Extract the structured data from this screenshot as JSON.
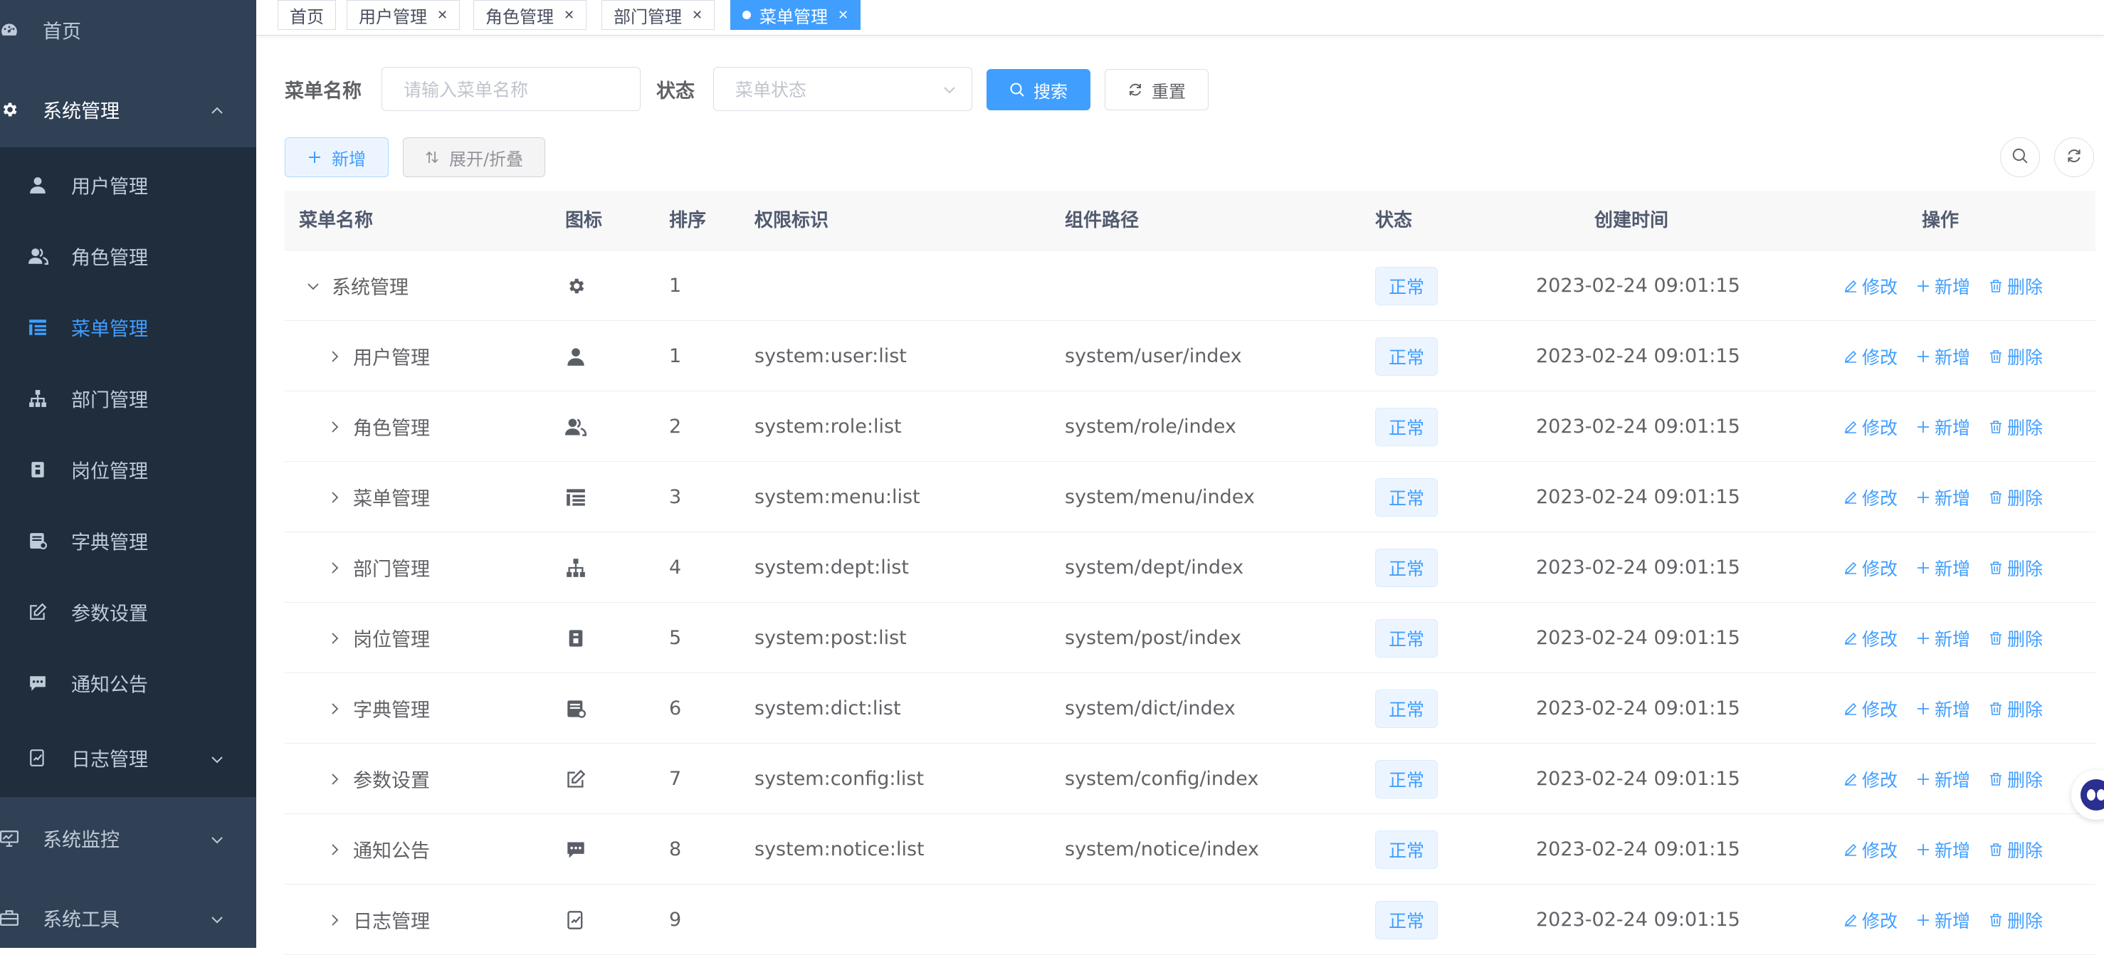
{
  "sidebar": {
    "items": [
      {
        "label": "首页",
        "icon": "dashboard-icon"
      },
      {
        "label": "系统管理",
        "icon": "gear-icon"
      },
      {
        "label": "用户管理",
        "icon": "user-icon"
      },
      {
        "label": "角色管理",
        "icon": "peoples-icon"
      },
      {
        "label": "菜单管理",
        "icon": "tree-table-icon"
      },
      {
        "label": "部门管理",
        "icon": "org-tree-icon"
      },
      {
        "label": "岗位管理",
        "icon": "post-icon"
      },
      {
        "label": "字典管理",
        "icon": "dict-icon"
      },
      {
        "label": "参数设置",
        "icon": "edit-icon"
      },
      {
        "label": "通知公告",
        "icon": "message-icon"
      },
      {
        "label": "日志管理",
        "icon": "log-icon"
      },
      {
        "label": "系统监控",
        "icon": "monitor-icon"
      },
      {
        "label": "系统工具",
        "icon": "tool-icon"
      }
    ]
  },
  "tags": [
    {
      "label": "首页"
    },
    {
      "label": "用户管理"
    },
    {
      "label": "角色管理"
    },
    {
      "label": "部门管理"
    },
    {
      "label": "菜单管理"
    }
  ],
  "query": {
    "menu_name_label": "菜单名称",
    "menu_name_placeholder": "请输入菜单名称",
    "status_label": "状态",
    "status_placeholder": "菜单状态",
    "search_label": "搜索",
    "reset_label": "重置"
  },
  "toolbar": {
    "add_label": "新增",
    "expand_label": "展开/折叠"
  },
  "table": {
    "headers": [
      "菜单名称",
      "图标",
      "排序",
      "权限标识",
      "组件路径",
      "状态",
      "创建时间",
      "操作"
    ],
    "actions": {
      "edit": "修改",
      "add": "新增",
      "delete": "删除"
    },
    "rows": [
      {
        "name": "系统管理",
        "icon": "gear-icon",
        "order": "1",
        "perm": "",
        "component": "",
        "status": "正常",
        "created": "2023-02-24 09:01:15",
        "expanded": true
      },
      {
        "name": "用户管理",
        "icon": "user-icon",
        "order": "1",
        "perm": "system:user:list",
        "component": "system/user/index",
        "status": "正常",
        "created": "2023-02-24 09:01:15"
      },
      {
        "name": "角色管理",
        "icon": "peoples-icon",
        "order": "2",
        "perm": "system:role:list",
        "component": "system/role/index",
        "status": "正常",
        "created": "2023-02-24 09:01:15"
      },
      {
        "name": "菜单管理",
        "icon": "tree-table-icon",
        "order": "3",
        "perm": "system:menu:list",
        "component": "system/menu/index",
        "status": "正常",
        "created": "2023-02-24 09:01:15"
      },
      {
        "name": "部门管理",
        "icon": "org-tree-icon",
        "order": "4",
        "perm": "system:dept:list",
        "component": "system/dept/index",
        "status": "正常",
        "created": "2023-02-24 09:01:15"
      },
      {
        "name": "岗位管理",
        "icon": "post-icon",
        "order": "5",
        "perm": "system:post:list",
        "component": "system/post/index",
        "status": "正常",
        "created": "2023-02-24 09:01:15"
      },
      {
        "name": "字典管理",
        "icon": "dict-icon",
        "order": "6",
        "perm": "system:dict:list",
        "component": "system/dict/index",
        "status": "正常",
        "created": "2023-02-24 09:01:15"
      },
      {
        "name": "参数设置",
        "icon": "edit-icon",
        "order": "7",
        "perm": "system:config:list",
        "component": "system/config/index",
        "status": "正常",
        "created": "2023-02-24 09:01:15"
      },
      {
        "name": "通知公告",
        "icon": "message-icon",
        "order": "8",
        "perm": "system:notice:list",
        "component": "system/notice/index",
        "status": "正常",
        "created": "2023-02-24 09:01:15"
      },
      {
        "name": "日志管理",
        "icon": "log-icon",
        "order": "9",
        "perm": "",
        "component": "",
        "status": "正常",
        "created": "2023-02-24 09:01:15"
      }
    ]
  },
  "colors": {
    "sidebar_bg": "#304156",
    "submenu_bg": "#1f2d3d",
    "accent": "#409eff",
    "sidebar_text": "#bfcbd9"
  }
}
